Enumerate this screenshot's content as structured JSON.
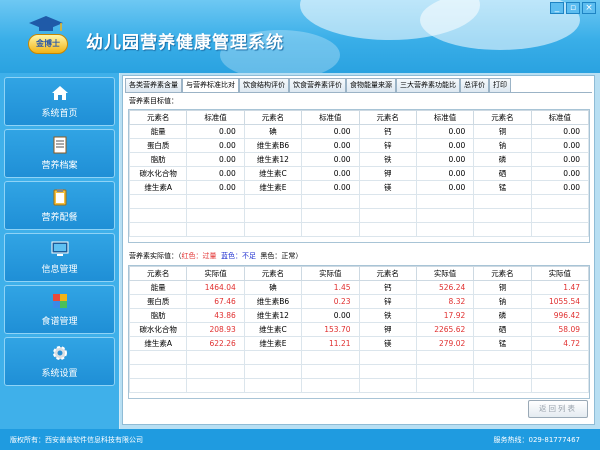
{
  "app": {
    "title": "幼儿园营养健康管理系统",
    "logo_text": "金博士",
    "window_buttons": [
      "_",
      "▫",
      "×"
    ]
  },
  "sidebar": {
    "items": [
      {
        "label": "系统首页",
        "icon": "home-icon"
      },
      {
        "label": "营养档案",
        "icon": "document-icon"
      },
      {
        "label": "营养配餐",
        "icon": "clipboard-icon"
      },
      {
        "label": "信息管理",
        "icon": "monitor-icon"
      },
      {
        "label": "食谱管理",
        "icon": "blocks-icon"
      },
      {
        "label": "系统设置",
        "icon": "gear-icon"
      }
    ]
  },
  "tabs": [
    {
      "label": "各类营养素含量",
      "active": false
    },
    {
      "label": "与营养标准比对",
      "active": true
    },
    {
      "label": "饮食结构评价",
      "active": false
    },
    {
      "label": "饮食营养素评价",
      "active": false
    },
    {
      "label": "食物能量来源",
      "active": false
    },
    {
      "label": "三大营养素功能比",
      "active": false
    },
    {
      "label": "总评价",
      "active": false
    },
    {
      "label": "打印",
      "active": false
    }
  ],
  "standard_section": {
    "label": "营养素目标值：",
    "headers": [
      "元素名",
      "标准值",
      "元素名",
      "标准值",
      "元素名",
      "标准值",
      "元素名",
      "标准值"
    ],
    "rows": [
      [
        "能量",
        "0.00",
        "碘",
        "0.00",
        "钙",
        "0.00",
        "铜",
        "0.00"
      ],
      [
        "蛋白质",
        "0.00",
        "维生素B6",
        "0.00",
        "锌",
        "0.00",
        "钠",
        "0.00"
      ],
      [
        "脂肪",
        "0.00",
        "维生素12",
        "0.00",
        "铁",
        "0.00",
        "磷",
        "0.00"
      ],
      [
        "碳水化合物",
        "0.00",
        "维生素C",
        "0.00",
        "钾",
        "0.00",
        "硒",
        "0.00"
      ],
      [
        "维生素A",
        "0.00",
        "维生素E",
        "0.00",
        "镁",
        "0.00",
        "锰",
        "0.00"
      ]
    ]
  },
  "actual_section": {
    "label_prefix": "营养素实际值：（",
    "legend_red": "红色：过量",
    "legend_blue": "蓝色：不足",
    "legend_black": "黑色：正常）",
    "headers": [
      "元素名",
      "实际值",
      "元素名",
      "实际值",
      "元素名",
      "实际值",
      "元素名",
      "实际值"
    ],
    "rows": [
      [
        "能量",
        "1464.04",
        "碘",
        "1.45",
        "钙",
        "526.24",
        "铜",
        "1.47"
      ],
      [
        "蛋白质",
        "67.46",
        "维生素B6",
        "0.23",
        "锌",
        "8.32",
        "钠",
        "1055.54"
      ],
      [
        "脂肪",
        "43.86",
        "维生素12",
        "0.00",
        "铁",
        "17.92",
        "磷",
        "996.42"
      ],
      [
        "碳水化合物",
        "208.93",
        "维生素C",
        "153.70",
        "钾",
        "2265.62",
        "硒",
        "58.09"
      ],
      [
        "维生素A",
        "622.26",
        "维生素E",
        "11.21",
        "镁",
        "279.02",
        "锰",
        "4.72"
      ]
    ],
    "red_cells": [
      [
        0,
        1
      ],
      [
        0,
        3
      ],
      [
        0,
        5
      ],
      [
        0,
        7
      ],
      [
        1,
        1
      ],
      [
        1,
        3
      ],
      [
        1,
        5
      ],
      [
        1,
        7
      ],
      [
        2,
        1
      ],
      [
        2,
        5
      ],
      [
        2,
        7
      ],
      [
        3,
        1
      ],
      [
        3,
        3
      ],
      [
        3,
        5
      ],
      [
        3,
        7
      ],
      [
        4,
        1
      ],
      [
        4,
        3
      ],
      [
        4,
        5
      ],
      [
        4,
        7
      ]
    ]
  },
  "back_button": "返回列表",
  "footer": {
    "copyright": "版权所有：西安善善软件信息科技有限公司",
    "hotline": "服务热线：029-81777467"
  },
  "colors": {
    "header": "#39aee8",
    "sidebar": "#3fb0ea",
    "footer": "#1f9be0",
    "excess": "#e03030",
    "deficient": "#2030d0"
  }
}
